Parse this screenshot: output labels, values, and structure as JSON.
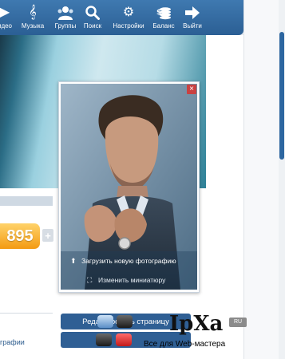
{
  "nav": {
    "video": {
      "label": "идео",
      "icon": "video-icon"
    },
    "music": {
      "label": "Музыка",
      "icon": "music-note-icon"
    },
    "groups": {
      "label": "Группы",
      "icon": "groups-icon"
    },
    "search": {
      "label": "Поиск",
      "icon": "search-icon"
    },
    "settings": {
      "label": "Настройки",
      "icon": "gear-icon"
    },
    "balance": {
      "label": "Баланс",
      "icon": "coins-icon"
    },
    "exit": {
      "label": "Выйти",
      "icon": "arrow-right-icon"
    }
  },
  "profile": {
    "points": "895",
    "plus": "+",
    "left_link": "графии"
  },
  "popup": {
    "close": "×",
    "upload_photo": "Загрузить новую фотографию",
    "change_thumbnail": "Изменить миниатюру"
  },
  "actions": {
    "edit_page": "Редактировать страницу"
  },
  "watermark": {
    "logo": "IpXa",
    "ru": "RU",
    "tagline": "Все для Web-мастера"
  },
  "colors": {
    "nav_bg": "#2b5f94",
    "points_orange": "#f39a13",
    "button_blue": "#2f5f94",
    "close_red": "#c94141"
  }
}
